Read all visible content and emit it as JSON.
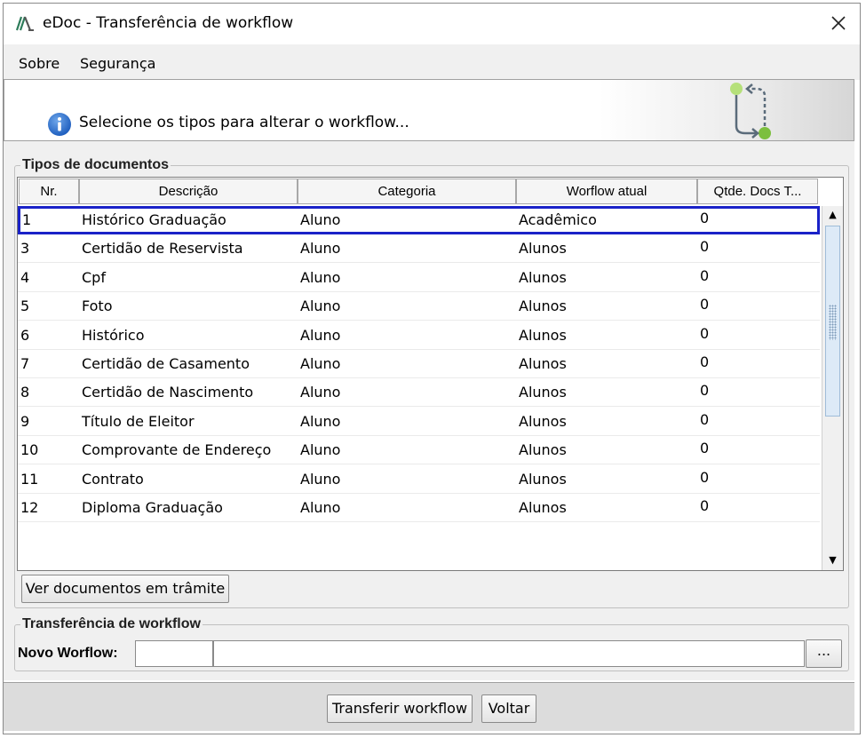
{
  "window": {
    "title": "eDoc - Transferência de workflow",
    "close_symbol": "✕"
  },
  "menu": [
    {
      "label": "Sobre"
    },
    {
      "label": "Segurança"
    }
  ],
  "header": {
    "info_text": "Selecione os tipos para alterar o workflow...",
    "icons": {
      "info": "info-icon",
      "workflow": "workflow-transfer-icon"
    }
  },
  "documents_group": {
    "title": "Tipos de documentos",
    "columns": [
      "Nr.",
      "Descrição",
      "Categoria",
      "Worflow atual",
      "Qtde. Docs T..."
    ],
    "rows": [
      {
        "nr": "1",
        "descricao": "Histórico Graduação",
        "categoria": "Aluno",
        "workflow": "Acadêmico",
        "qtde": "0",
        "selected": true
      },
      {
        "nr": "3",
        "descricao": "Certidão de Reservista",
        "categoria": "Aluno",
        "workflow": "Alunos",
        "qtde": "0"
      },
      {
        "nr": "4",
        "descricao": "Cpf",
        "categoria": "Aluno",
        "workflow": "Alunos",
        "qtde": "0"
      },
      {
        "nr": "5",
        "descricao": "Foto",
        "categoria": "Aluno",
        "workflow": "Alunos",
        "qtde": "0"
      },
      {
        "nr": "6",
        "descricao": "Histórico",
        "categoria": "Aluno",
        "workflow": "Alunos",
        "qtde": "0"
      },
      {
        "nr": "7",
        "descricao": "Certidão de Casamento",
        "categoria": "Aluno",
        "workflow": "Alunos",
        "qtde": "0"
      },
      {
        "nr": "8",
        "descricao": "Certidão de Nascimento",
        "categoria": "Aluno",
        "workflow": "Alunos",
        "qtde": "0"
      },
      {
        "nr": "9",
        "descricao": "Título de Eleitor",
        "categoria": "Aluno",
        "workflow": "Alunos",
        "qtde": "0"
      },
      {
        "nr": "10",
        "descricao": "Comprovante de Endereço",
        "categoria": "Aluno",
        "workflow": "Alunos",
        "qtde": "0"
      },
      {
        "nr": "11",
        "descricao": "Contrato",
        "categoria": "Aluno",
        "workflow": "Alunos",
        "qtde": "0"
      },
      {
        "nr": "12",
        "descricao": "Diploma Graduação",
        "categoria": "Aluno",
        "workflow": "Alunos",
        "qtde": "0"
      }
    ],
    "ver_button": "Ver documentos em trâmite"
  },
  "transfer_group": {
    "title": "Transferência de workflow",
    "novo_label": "Novo Worflow:",
    "code_value": "",
    "name_value": "",
    "browse_button": "..."
  },
  "footer": {
    "transfer_button": "Transferir workflow",
    "back_button": "Voltar"
  },
  "colors": {
    "selection_outline": "#1a22c8",
    "info_blue": "#1f5fbf",
    "workflow_green": "#8bc34a"
  }
}
